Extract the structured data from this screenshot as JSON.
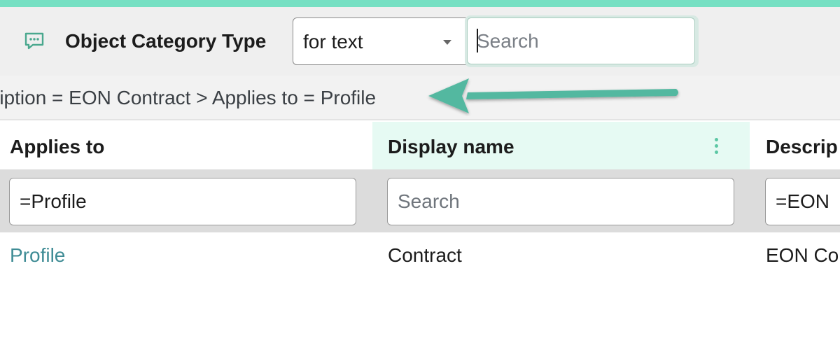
{
  "header": {
    "icon": "comment-icon",
    "title": "Object Category Type",
    "type_select": {
      "value": "for text",
      "caret_icon": "caret-down-icon"
    },
    "search": {
      "placeholder": "Search",
      "value": ""
    }
  },
  "breadcrumb": {
    "text": "ription = EON Contract > Applies to = Profile",
    "annotation_arrow_color": "#52b8a0"
  },
  "table": {
    "columns": [
      {
        "label": "Applies to",
        "filter_value": "=Profile",
        "filter_placeholder": ""
      },
      {
        "label": "Display name",
        "filter_value": "",
        "filter_placeholder": "Search",
        "active": true,
        "menu_icon": "kebab-menu-icon"
      },
      {
        "label": "Descrip",
        "filter_value": "=EON",
        "filter_placeholder": ""
      }
    ],
    "rows": [
      {
        "applies_to": "Profile",
        "display_name": "Contract",
        "description": "EON Co"
      }
    ]
  },
  "colors": {
    "accent": "#76e0c3",
    "link": "#3f8c95",
    "active_column": "#e6faf3"
  }
}
